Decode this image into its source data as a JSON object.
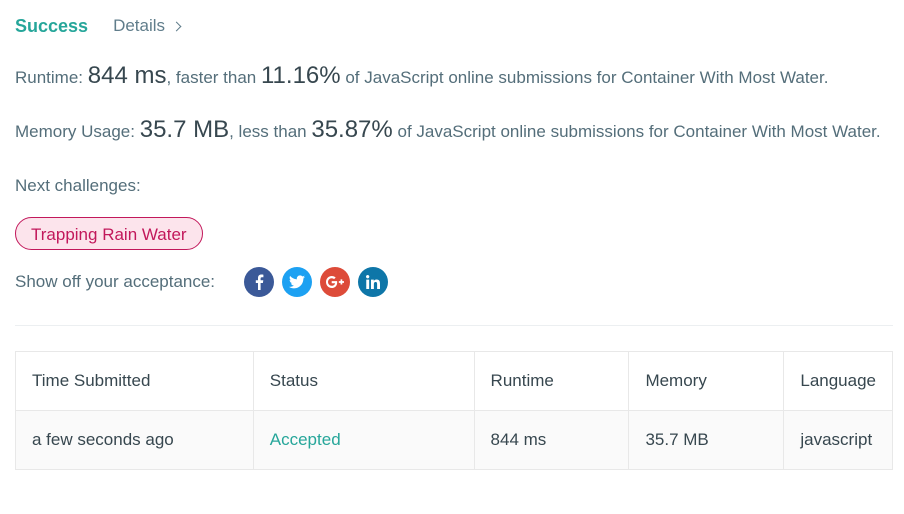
{
  "header": {
    "status": "Success",
    "details_label": "Details"
  },
  "runtime": {
    "label": "Runtime:",
    "value": "844 ms",
    "comparison": ", faster than",
    "percent": "11.16%",
    "suffix": "of JavaScript online submissions for Container With Most Water."
  },
  "memory": {
    "label": "Memory Usage:",
    "value": "35.7 MB",
    "comparison": ", less than",
    "percent": "35.87%",
    "suffix": "of JavaScript online submissions for Container With Most Water."
  },
  "next": {
    "label": "Next challenges:",
    "challenges": [
      "Trapping Rain Water"
    ]
  },
  "share": {
    "label": "Show off your acceptance:",
    "icons": [
      "facebook-icon",
      "twitter-icon",
      "google-plus-icon",
      "linkedin-icon"
    ],
    "colors": {
      "facebook": "#3b5998",
      "twitter": "#1da1f2",
      "google_plus": "#dd4b39",
      "linkedin": "#0e76a8"
    }
  },
  "table": {
    "columns": [
      "Time Submitted",
      "Status",
      "Runtime",
      "Memory",
      "Language"
    ],
    "rows": [
      [
        "a few seconds ago",
        "Accepted",
        "844 ms",
        "35.7 MB",
        "javascript"
      ]
    ]
  },
  "colors": {
    "success": "#26a69a",
    "challenge_pill": "#c2185b",
    "challenge_pill_bg": "#fce4ec"
  }
}
